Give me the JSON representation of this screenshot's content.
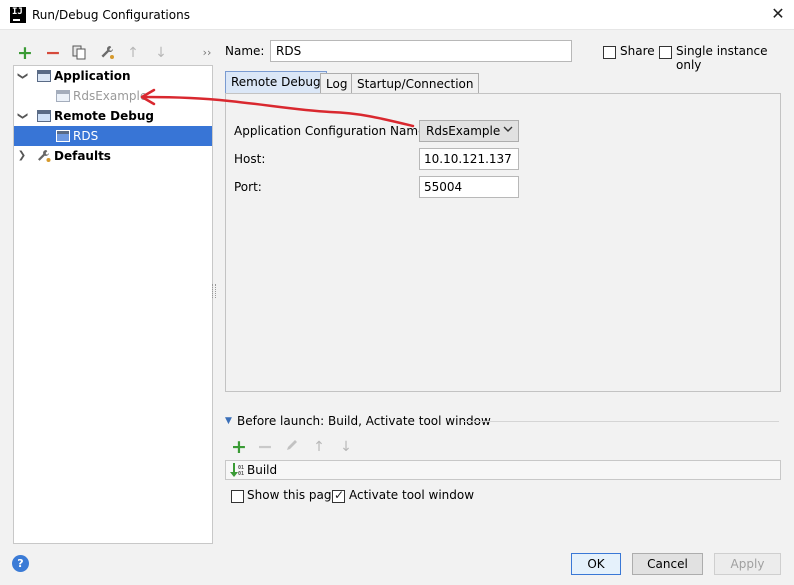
{
  "window": {
    "title": "Run/Debug Configurations",
    "close_icon": "✕"
  },
  "toolbar": {
    "add": "+",
    "remove": "−",
    "copy": "⧉",
    "edit": "🔧",
    "up": "↑",
    "down": "↓",
    "more": "››"
  },
  "tree": {
    "items": [
      {
        "label": "Application"
      },
      {
        "label": "RdsExample"
      },
      {
        "label": "Remote Debug"
      },
      {
        "label": "RDS"
      },
      {
        "label": "Defaults"
      }
    ],
    "expanded_icon": "❯",
    "selected": "RDS"
  },
  "header": {
    "name_label": "Name:",
    "name_value": "RDS",
    "share_label": "Share",
    "share_checked": false,
    "single_instance_label": "Single instance only",
    "single_instance_checked": false
  },
  "tabs": [
    {
      "label": "Remote Debug",
      "active": true
    },
    {
      "label": "Log",
      "active": false
    },
    {
      "label": "Startup/Connection",
      "active": false
    }
  ],
  "form": {
    "app_conf_label": "Application Configuration Name:",
    "app_conf_value": "RdsExample",
    "host_label": "Host:",
    "host_value": "10.10.121.137",
    "port_label": "Port:",
    "port_value": "55004"
  },
  "before_launch": {
    "label": "Before launch: Build, Activate tool window",
    "items": [
      {
        "label": "Build"
      }
    ],
    "show_page_label": "Show this page",
    "show_page_checked": false,
    "activate_label": "Activate tool window",
    "activate_checked": true
  },
  "buttons": {
    "help": "?",
    "ok": "OK",
    "cancel": "Cancel",
    "apply": "Apply"
  },
  "colors": {
    "selection": "#3875d6",
    "annotation": "#d9282f",
    "add": "#3a9b35",
    "remove": "#d64a3b"
  }
}
